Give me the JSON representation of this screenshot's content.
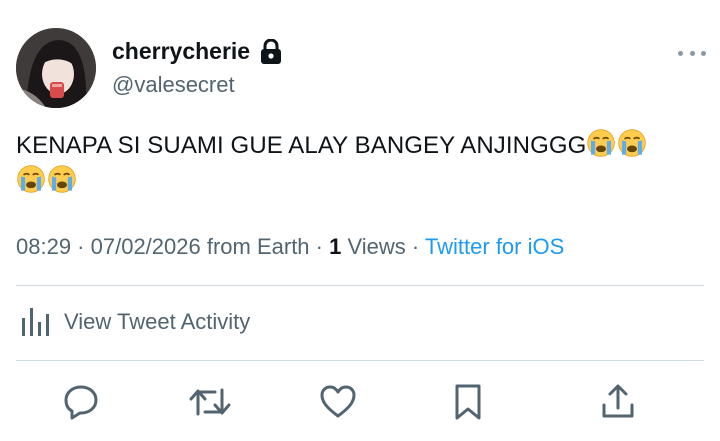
{
  "user": {
    "display_name": "cherrycherie",
    "handle": "@valesecret",
    "avatar_icon": "profile-photo",
    "protected_icon": "lock-icon"
  },
  "tweet": {
    "text_line1": "KENAPA SI SUAMI GUE ALAY BANGEY ANJINGGG",
    "emoji": "loudly-crying-face"
  },
  "meta": {
    "time": "08:29",
    "sep1": " · ",
    "date": "07/02/2026",
    "location": " from Earth",
    "sep2": " · ",
    "views_count": "1",
    "views_label": " Views",
    "sep3": " · ",
    "source": "Twitter for iOS"
  },
  "activity": {
    "label": "View Tweet Activity",
    "icon": "bar-chart-icon"
  },
  "actions": [
    {
      "name": "reply",
      "icon": "reply-icon"
    },
    {
      "name": "retweet",
      "icon": "retweet-icon"
    },
    {
      "name": "like",
      "icon": "heart-icon"
    },
    {
      "name": "bookmark",
      "icon": "bookmark-icon"
    },
    {
      "name": "share",
      "icon": "share-icon"
    }
  ],
  "colors": {
    "link": "#1d9bf0",
    "secondary_text": "#536471",
    "primary_text": "#0f1419",
    "divider": "#cfd9de"
  }
}
